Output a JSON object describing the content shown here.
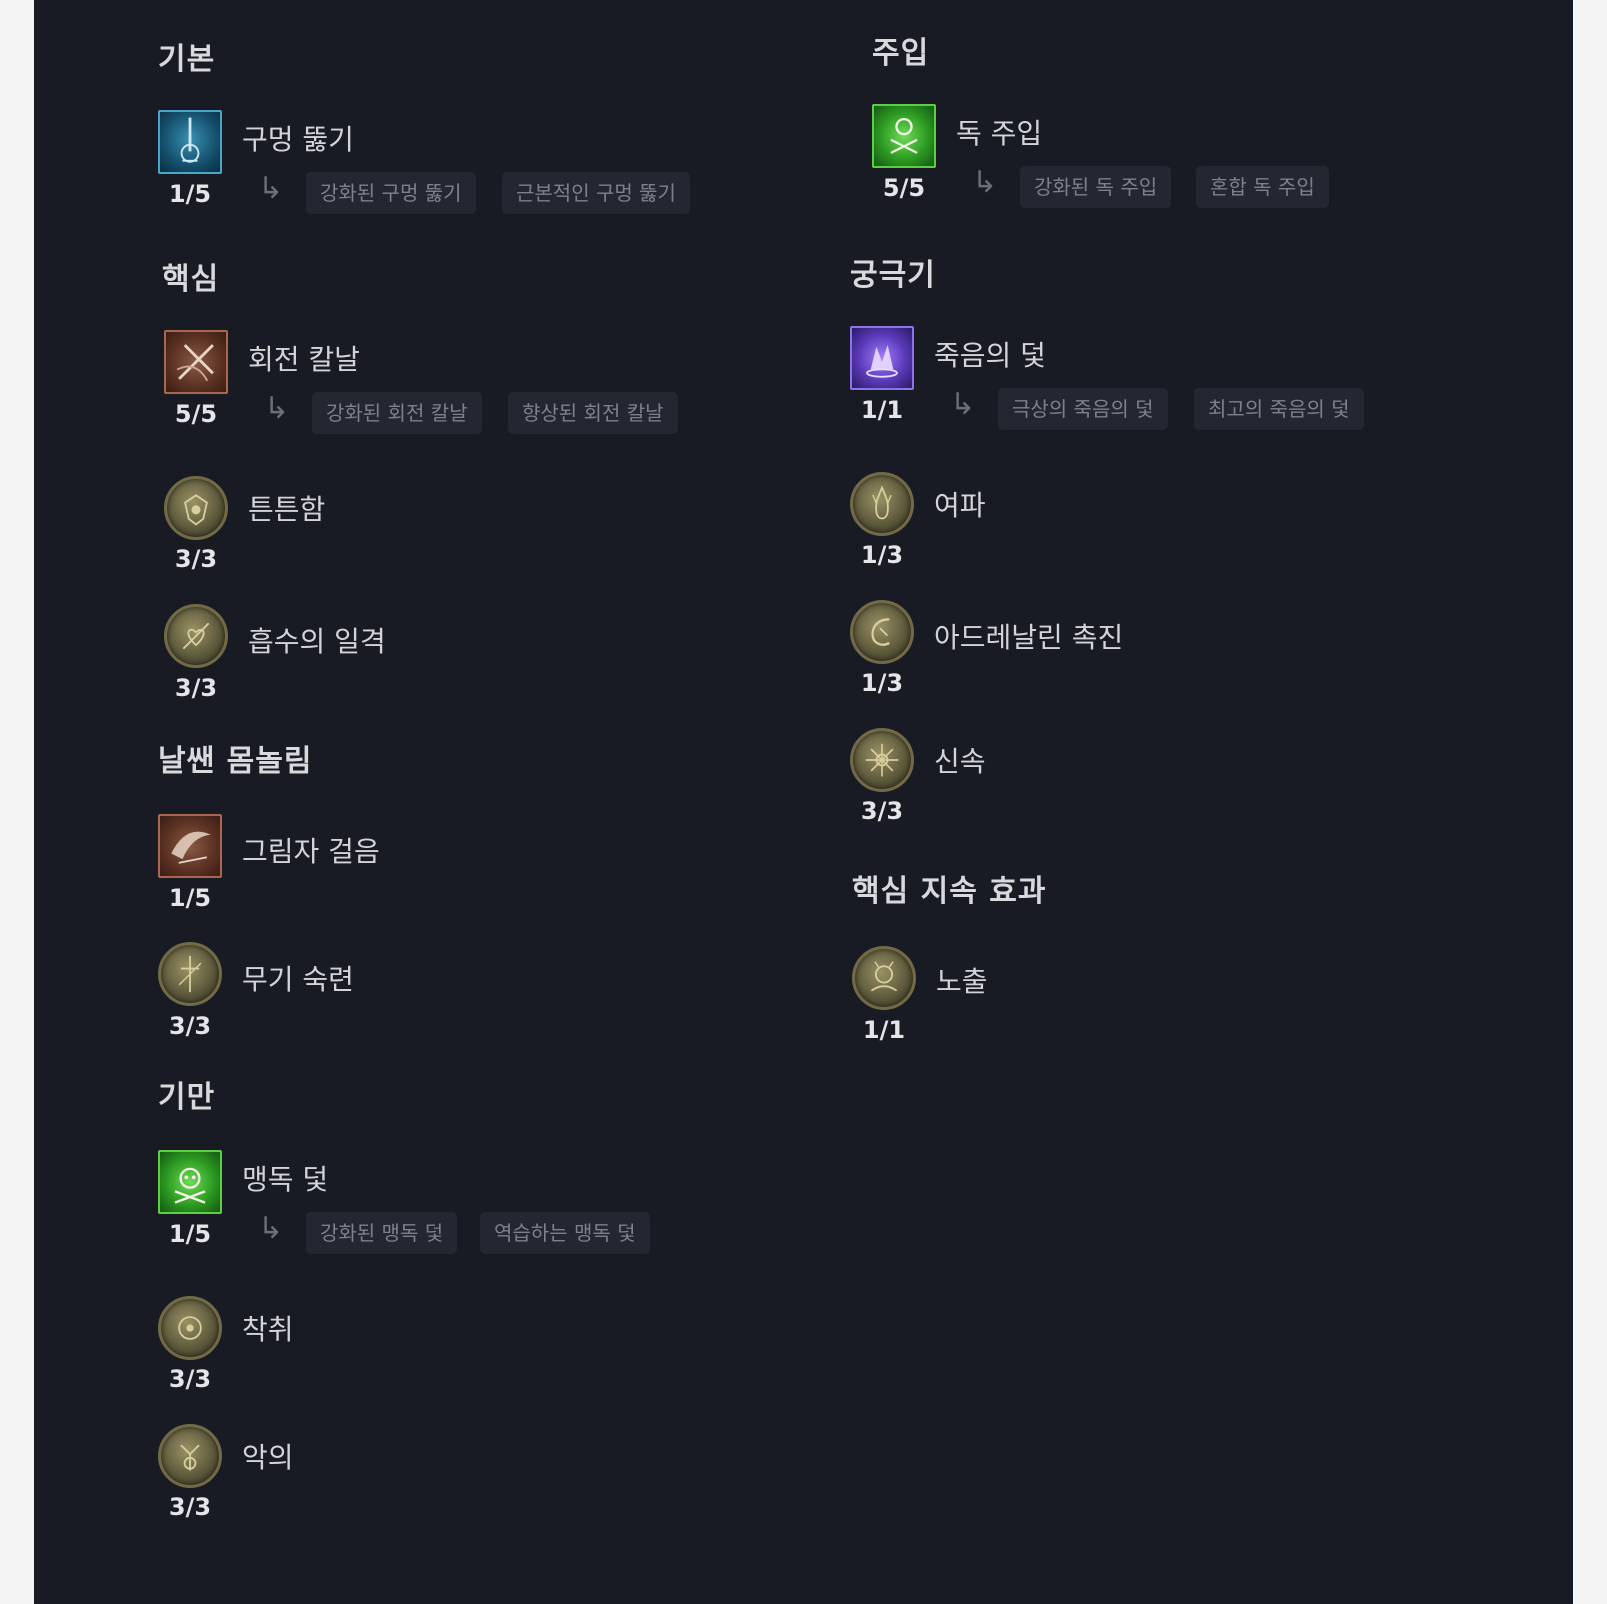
{
  "sections": {
    "basic": "기본",
    "core": "핵심",
    "agility": "날쌘 몸놀림",
    "subterfuge": "기만",
    "imbuement": "주입",
    "ultimate": "궁극기",
    "key_passive": "핵심 지속 효과"
  },
  "skills": {
    "puncture": {
      "name": "구멍 뚫기",
      "points": "1/5",
      "upgrades": [
        "강화된 구멍 뚫기",
        "근본적인 구멍 뚫기"
      ],
      "icon": "puncture-icon"
    },
    "twisting_blades": {
      "name": "회전 칼날",
      "points": "5/5",
      "upgrades": [
        "강화된 회전 칼날",
        "향상된 회전 칼날"
      ],
      "icon": "twisting-blades-icon"
    },
    "sturdy": {
      "name": "튼튼함",
      "points": "3/3",
      "icon": "sturdy-icon"
    },
    "siphoning_strikes": {
      "name": "흡수의 일격",
      "points": "3/3",
      "icon": "siphoning-strikes-icon"
    },
    "shadow_step": {
      "name": "그림자 걸음",
      "points": "1/5",
      "icon": "shadow-step-icon"
    },
    "weapon_mastery": {
      "name": "무기 숙련",
      "points": "3/3",
      "icon": "weapon-mastery-icon"
    },
    "poison_trap": {
      "name": "맹독 덫",
      "points": "1/5",
      "upgrades": [
        "강화된 맹독 덫",
        "역습하는 맹독 덫"
      ],
      "icon": "poison-trap-icon"
    },
    "exploit": {
      "name": "착취",
      "points": "3/3",
      "icon": "exploit-icon"
    },
    "malice": {
      "name": "악의",
      "points": "3/3",
      "icon": "malice-icon"
    },
    "poison_imbuement": {
      "name": "독 주입",
      "points": "5/5",
      "upgrades": [
        "강화된 독 주입",
        "혼합 독 주입"
      ],
      "icon": "poison-imbuement-icon"
    },
    "death_trap": {
      "name": "죽음의 덫",
      "points": "1/1",
      "upgrades": [
        "극상의 죽음의 덫",
        "최고의 죽음의 덫"
      ],
      "icon": "death-trap-icon"
    },
    "aftermath": {
      "name": "여파",
      "points": "1/3",
      "icon": "aftermath-icon"
    },
    "adrenaline_rush": {
      "name": "아드레날린 촉진",
      "points": "1/3",
      "icon": "adrenaline-rush-icon"
    },
    "haste": {
      "name": "신속",
      "points": "3/3",
      "icon": "haste-icon"
    },
    "exposure": {
      "name": "노출",
      "points": "1/1",
      "icon": "exposure-icon"
    }
  },
  "upgrade_arrow": "↳"
}
